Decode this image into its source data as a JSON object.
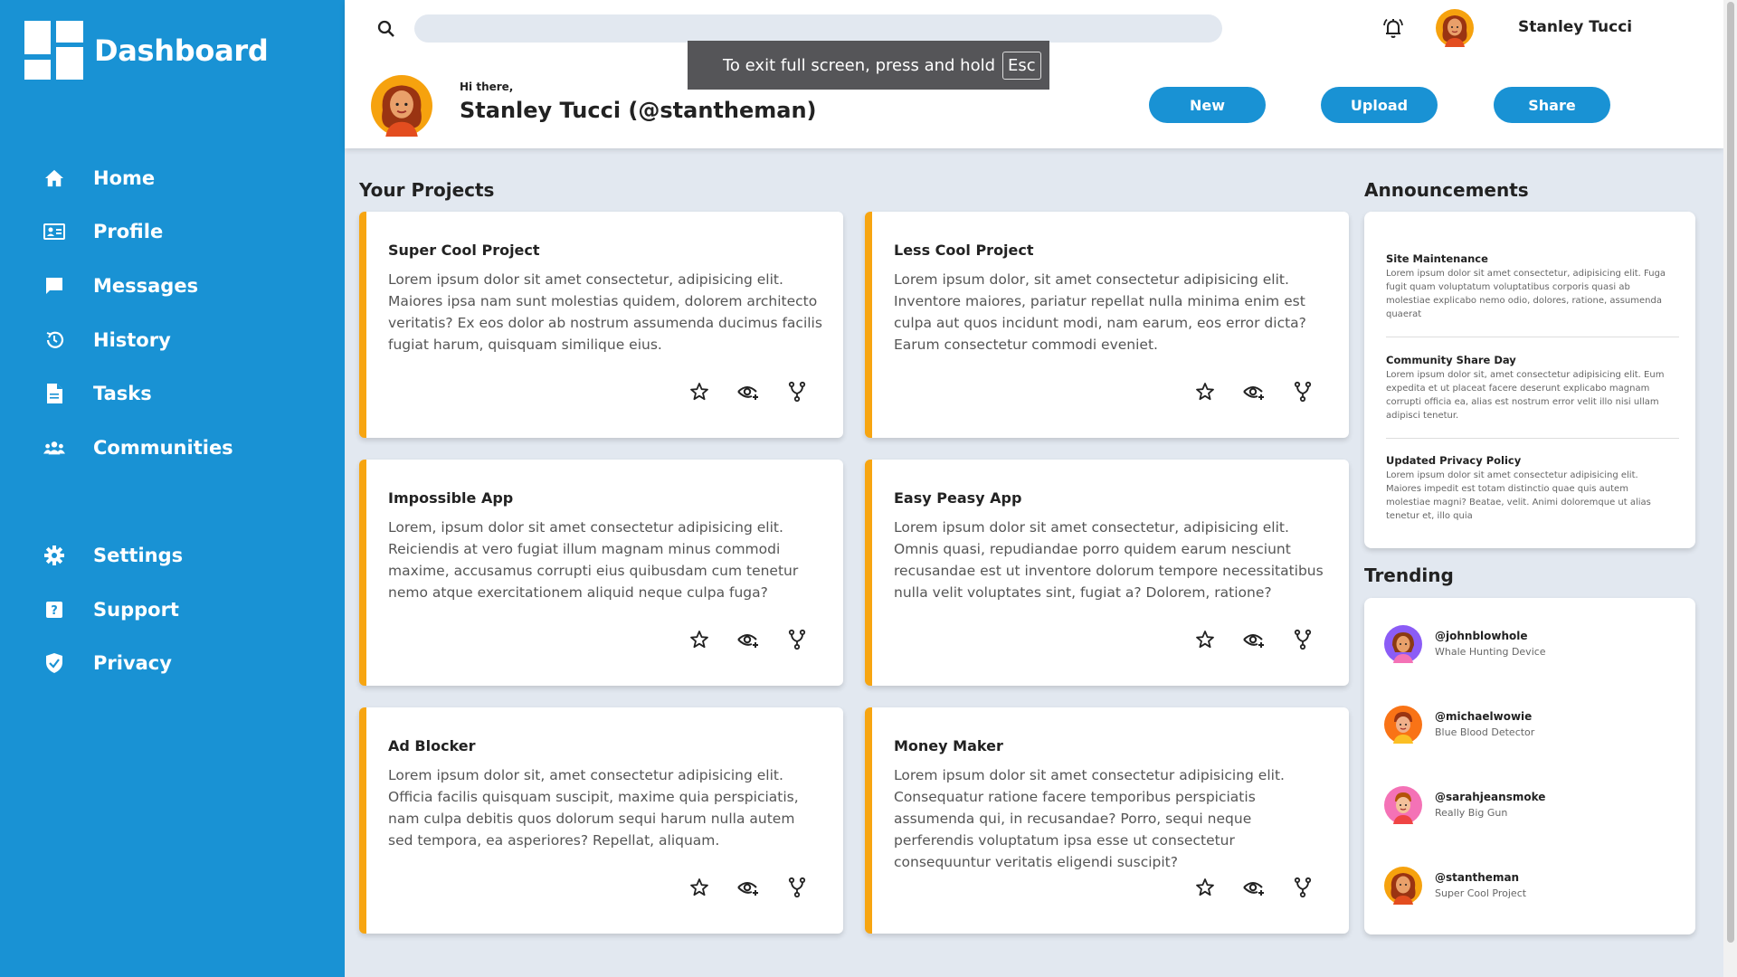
{
  "sidebar": {
    "brand": "Dashboard",
    "items": [
      {
        "label": "Home",
        "icon": "home-icon"
      },
      {
        "label": "Profile",
        "icon": "id-card-icon"
      },
      {
        "label": "Messages",
        "icon": "message-icon"
      },
      {
        "label": "History",
        "icon": "history-icon"
      },
      {
        "label": "Tasks",
        "icon": "document-icon"
      },
      {
        "label": "Communities",
        "icon": "people-icon"
      }
    ],
    "secondary_items": [
      {
        "label": "Settings",
        "icon": "gear-icon"
      },
      {
        "label": "Support",
        "icon": "help-icon"
      },
      {
        "label": "Privacy",
        "icon": "shield-icon"
      }
    ]
  },
  "header": {
    "search_placeholder": "",
    "username": "Stanley Tucci",
    "greeting": "Hi there,",
    "fullname": "Stanley Tucci (@stantheman)",
    "buttons": {
      "new": "New",
      "upload": "Upload",
      "share": "Share"
    }
  },
  "toast": {
    "text": "To exit full screen, press and hold",
    "key": "Esc"
  },
  "projects": {
    "title": "Your Projects",
    "items": [
      {
        "title": "Super Cool Project",
        "text": "Lorem ipsum dolor sit amet consectetur, adipisicing elit. Maiores ipsa nam sunt molestias quidem, dolorem architecto veritatis? Ex eos dolor ab nostrum assumenda ducimus facilis fugiat harum, quisquam similique eius."
      },
      {
        "title": "Less Cool Project",
        "text": "Lorem ipsum dolor, sit amet consectetur adipisicing elit. Inventore maiores, pariatur repellat nulla minima enim est culpa aut quos incidunt modi, nam earum, eos error dicta? Earum consectetur commodi eveniet."
      },
      {
        "title": "Impossible App",
        "text": "Lorem, ipsum dolor sit amet consectetur adipisicing elit. Reiciendis at vero fugiat illum magnam minus commodi maxime, accusamus corrupti eius quibusdam cum tenetur nemo atque exercitationem aliquid neque culpa fuga?"
      },
      {
        "title": "Easy Peasy App",
        "text": "Lorem ipsum dolor sit amet consectetur, adipisicing elit. Omnis quasi, repudiandae porro quidem earum nesciunt recusandae est ut inventore dolorum tempore necessitatibus nulla velit voluptates sint, fugiat a? Dolorem, ratione?"
      },
      {
        "title": "Ad Blocker",
        "text": "Lorem ipsum dolor sit, amet consectetur adipisicing elit. Officia facilis quisquam suscipit, maxime quia perspiciatis, nam culpa debitis quos dolorum sequi harum nulla autem sed tempora, ea asperiores? Repellat, aliquam."
      },
      {
        "title": "Money Maker",
        "text": "Lorem ipsum dolor sit amet consectetur adipisicing elit. Consequatur ratione facere temporibus perspiciatis assumenda qui, in recusandae? Porro, sequi neque perferendis voluptatum ipsa esse ut consectetur consequuntur veritatis eligendi suscipit?"
      }
    ],
    "action_icons": [
      "star-icon",
      "watch-icon",
      "fork-icon"
    ]
  },
  "announcements": {
    "title": "Announcements",
    "items": [
      {
        "title": "Site Maintenance",
        "text": "Lorem ipsum dolor sit amet consectetur, adipisicing elit. Fuga fugit quam voluptatum voluptatibus corporis quasi ab molestiae explicabo nemo odio, dolores, ratione, assumenda quaerat"
      },
      {
        "title": "Community Share Day",
        "text": "Lorem ipsum dolor sit, amet consectetur adipisicing elit. Eum expedita et ut placeat facere deserunt explicabo magnam corrupti officia ea, alias est nostrum error velit illo nisi ullam adipisci tenetur."
      },
      {
        "title": "Updated Privacy Policy",
        "text": "Lorem ipsum dolor sit amet consectetur adipisicing elit. Maiores impedit est totam distinctio quae quis autem molestiae magni? Beatae, velit. Animi doloremque ut alias tenetur et, illo quia"
      }
    ]
  },
  "trending": {
    "title": "Trending",
    "items": [
      {
        "handle": "@johnblowhole",
        "project": "Whale Hunting Device"
      },
      {
        "handle": "@michaelwowie",
        "project": "Blue Blood Detector"
      },
      {
        "handle": "@sarahjeansmoke",
        "project": "Really Big Gun"
      },
      {
        "handle": "@stantheman",
        "project": "Super Cool Project"
      }
    ]
  },
  "colors": {
    "sidebar": "#1992d4",
    "accent": "#f7a511",
    "background": "#e2e8f0"
  }
}
